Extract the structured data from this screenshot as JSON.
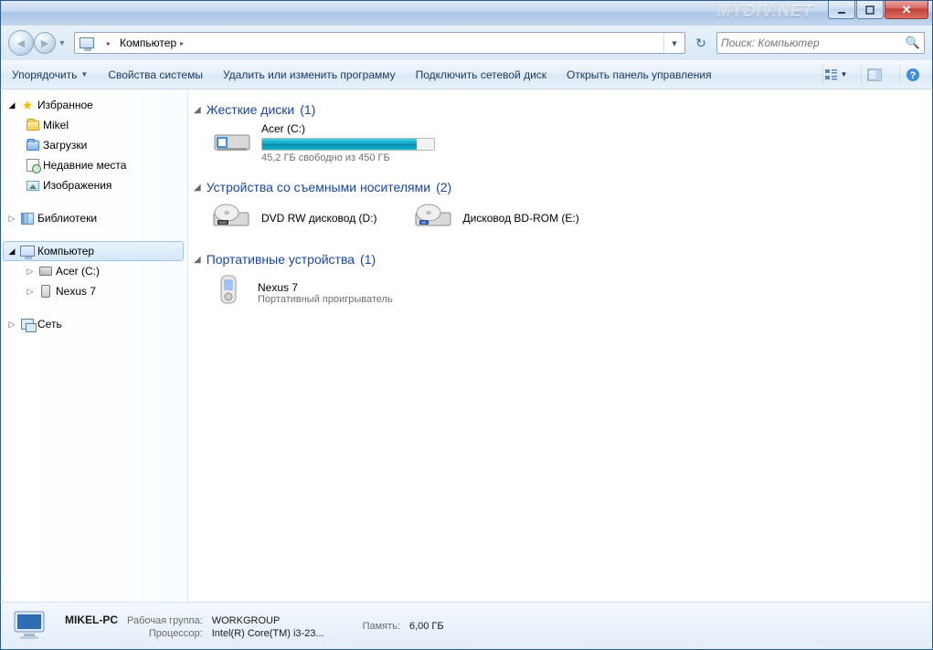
{
  "watermark": "MYDIV.NET",
  "nav": {
    "location_label": "Компьютер",
    "search_placeholder": "Поиск: Компьютер"
  },
  "toolbar": {
    "organize": "Упорядочить",
    "system_props": "Свойства системы",
    "uninstall": "Удалить или изменить программу",
    "map_drive": "Подключить сетевой диск",
    "control_panel": "Открыть панель управления"
  },
  "sidebar": {
    "favorites": "Избранное",
    "fav_items": {
      "mikel": "Mikel",
      "downloads": "Загрузки",
      "recent": "Недавние места",
      "pictures": "Изображения"
    },
    "libraries": "Библиотеки",
    "computer": "Компьютер",
    "computer_items": {
      "acer": "Acer (C:)",
      "nexus": "Nexus 7"
    },
    "network": "Сеть"
  },
  "groups": {
    "hdd": {
      "title": "Жесткие диски",
      "count": "(1)"
    },
    "removable": {
      "title": "Устройства со съемными носителями",
      "count": "(2)"
    },
    "portable": {
      "title": "Портативные устройства",
      "count": "(1)"
    }
  },
  "drives": {
    "acer": {
      "name": "Acer (C:)",
      "free": "45,2 ГБ свободно из 450 ГБ"
    },
    "dvd": {
      "name": "DVD RW дисковод (D:)"
    },
    "bd": {
      "name": "Дисковод BD-ROM (E:)"
    },
    "nexus": {
      "name": "Nexus 7",
      "sub": "Портативный проигрыватель"
    }
  },
  "status": {
    "pc_name": "MIKEL-PC",
    "workgroup_key": "Рабочая группа:",
    "workgroup": "WORKGROUP",
    "cpu_key": "Процессор:",
    "cpu": "Intel(R) Core(TM) i3-23...",
    "mem_key": "Память:",
    "mem": "6,00 ГБ"
  }
}
